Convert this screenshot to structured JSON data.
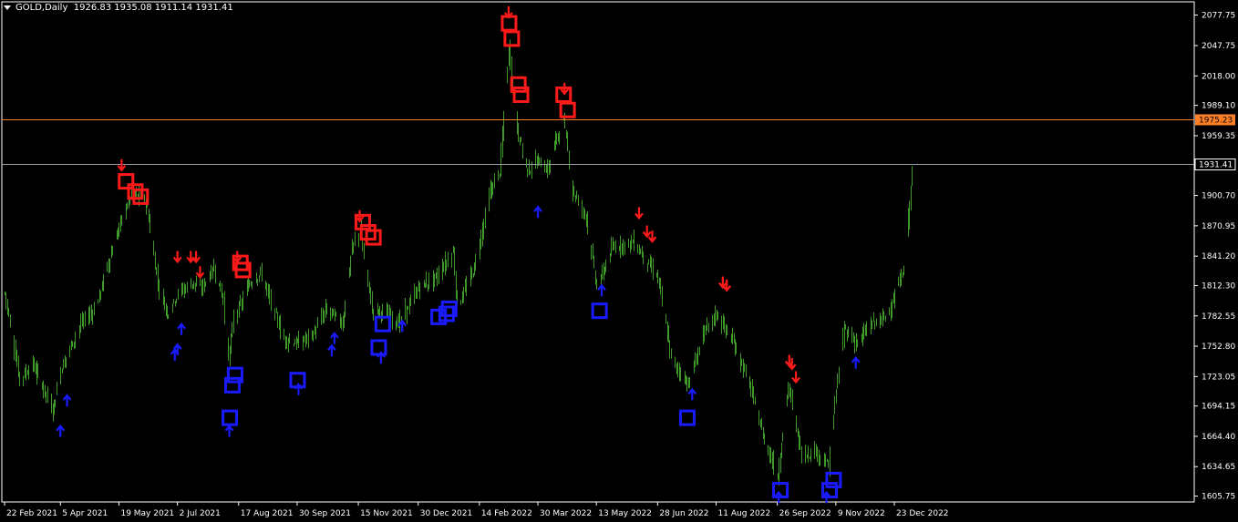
{
  "header": {
    "symbol": "GOLD,Daily",
    "ohlc": "1926.83 1935.08 1911.14 1931.41"
  },
  "colors": {
    "background": "#000000",
    "candle": "#3f9a2a",
    "axis": "#ffffff",
    "sell_signal": "#ff1a1a",
    "buy_signal": "#1a1aff",
    "resistance_line": "#ff7f27",
    "current_line": "#9a9aa8"
  },
  "chart_data": {
    "type": "ohlc-bar",
    "title": "GOLD,Daily",
    "y_ticks": [
      "2077.75",
      "2047.75",
      "2018.00",
      "1989.10",
      "1959.35",
      "1900.70",
      "1870.95",
      "1841.20",
      "1812.30",
      "1782.55",
      "1752.80",
      "1723.05",
      "1694.15",
      "1664.40",
      "1634.65",
      "1605.75"
    ],
    "ylim": [
      1600,
      2088
    ],
    "x_ticks": [
      {
        "label": "22 Feb 2021",
        "date": "2021-02-22"
      },
      {
        "label": "5 Apr 2021",
        "date": "2021-04-05"
      },
      {
        "label": "19 May 2021",
        "date": "2021-05-19"
      },
      {
        "label": "2 Jul 2021",
        "date": "2021-07-02"
      },
      {
        "label": "17 Aug 2021",
        "date": "2021-08-17"
      },
      {
        "label": "30 Sep 2021",
        "date": "2021-09-30"
      },
      {
        "label": "15 Nov 2021",
        "date": "2021-11-15"
      },
      {
        "label": "30 Dec 2021",
        "date": "2021-12-30"
      },
      {
        "label": "14 Feb 2022",
        "date": "2022-02-14"
      },
      {
        "label": "30 Mar 2022",
        "date": "2022-03-30"
      },
      {
        "label": "13 May 2022",
        "date": "2022-05-13"
      },
      {
        "label": "28 Jun 2022",
        "date": "2022-06-28"
      },
      {
        "label": "11 Aug 2022",
        "date": "2022-08-11"
      },
      {
        "label": "26 Sep 2022",
        "date": "2022-09-26"
      },
      {
        "label": "9 Nov 2022",
        "date": "2022-11-09"
      },
      {
        "label": "23 Dec 2022",
        "date": "2022-12-23"
      }
    ],
    "date_range": [
      "2021-02-22",
      "2023-01-05"
    ],
    "series": [
      {
        "points": [
          [
            "2021-02-22",
            1805
          ],
          [
            "2021-03-05",
            1720
          ],
          [
            "2021-03-15",
            1735
          ],
          [
            "2021-03-30",
            1690
          ],
          [
            "2021-04-05",
            1730
          ],
          [
            "2021-04-20",
            1775
          ],
          [
            "2021-05-01",
            1790
          ],
          [
            "2021-05-12",
            1840
          ],
          [
            "2021-05-19",
            1870
          ],
          [
            "2021-05-28",
            1905
          ],
          [
            "2021-06-08",
            1895
          ],
          [
            "2021-06-17",
            1815
          ],
          [
            "2021-06-24",
            1785
          ],
          [
            "2021-07-02",
            1805
          ],
          [
            "2021-07-13",
            1815
          ],
          [
            "2021-07-20",
            1810
          ],
          [
            "2021-07-29",
            1830
          ],
          [
            "2021-08-05",
            1800
          ],
          [
            "2021-08-09",
            1740
          ],
          [
            "2021-08-13",
            1780
          ],
          [
            "2021-08-17",
            1790
          ],
          [
            "2021-08-25",
            1815
          ],
          [
            "2021-09-03",
            1825
          ],
          [
            "2021-09-10",
            1795
          ],
          [
            "2021-09-20",
            1760
          ],
          [
            "2021-09-30",
            1755
          ],
          [
            "2021-10-12",
            1765
          ],
          [
            "2021-10-22",
            1790
          ],
          [
            "2021-11-03",
            1775
          ],
          [
            "2021-11-10",
            1850
          ],
          [
            "2021-11-16",
            1865
          ],
          [
            "2021-11-25",
            1790
          ],
          [
            "2021-12-06",
            1785
          ],
          [
            "2021-12-15",
            1775
          ],
          [
            "2021-12-30",
            1810
          ],
          [
            "2022-01-12",
            1820
          ],
          [
            "2022-01-25",
            1845
          ],
          [
            "2022-01-28",
            1790
          ],
          [
            "2022-02-10",
            1830
          ],
          [
            "2022-02-22",
            1905
          ],
          [
            "2022-03-01",
            1925
          ],
          [
            "2022-03-08",
            2045
          ],
          [
            "2022-03-14",
            1965
          ],
          [
            "2022-03-22",
            1925
          ],
          [
            "2022-03-30",
            1935
          ],
          [
            "2022-04-06",
            1925
          ],
          [
            "2022-04-12",
            1955
          ],
          [
            "2022-04-18",
            1975
          ],
          [
            "2022-04-25",
            1905
          ],
          [
            "2022-05-05",
            1880
          ],
          [
            "2022-05-13",
            1810
          ],
          [
            "2022-05-25",
            1850
          ],
          [
            "2022-06-10",
            1855
          ],
          [
            "2022-06-20",
            1835
          ],
          [
            "2022-06-28",
            1820
          ],
          [
            "2022-07-08",
            1740
          ],
          [
            "2022-07-21",
            1715
          ],
          [
            "2022-08-01",
            1765
          ],
          [
            "2022-08-11",
            1785
          ],
          [
            "2022-08-24",
            1755
          ],
          [
            "2022-09-05",
            1715
          ],
          [
            "2022-09-15",
            1665
          ],
          [
            "2022-09-26",
            1625
          ],
          [
            "2022-10-04",
            1715
          ],
          [
            "2022-10-14",
            1645
          ],
          [
            "2022-10-25",
            1650
          ],
          [
            "2022-11-03",
            1635
          ],
          [
            "2022-11-09",
            1710
          ],
          [
            "2022-11-15",
            1770
          ],
          [
            "2022-11-25",
            1755
          ],
          [
            "2022-12-05",
            1775
          ],
          [
            "2022-12-15",
            1780
          ],
          [
            "2022-12-23",
            1800
          ],
          [
            "2022-12-30",
            1830
          ],
          [
            "2023-01-05",
            1925
          ]
        ]
      }
    ],
    "horizontal_lines": [
      {
        "price": 1975.23,
        "label": "1975.23",
        "color": "#ff7f27",
        "label_style": "filled"
      },
      {
        "price": 1931.41,
        "label": "1931.41",
        "color": "#9a9aa8",
        "label_style": "outline"
      }
    ],
    "signals": {
      "sell_boxes": [
        [
          "2021-05-24",
          1915
        ],
        [
          "2021-05-31",
          1905
        ],
        [
          "2021-06-04",
          1900
        ],
        [
          "2021-11-18",
          1875
        ],
        [
          "2021-11-22",
          1865
        ],
        [
          "2021-11-26",
          1860
        ],
        [
          "2021-08-18",
          1835
        ],
        [
          "2021-08-20",
          1828
        ],
        [
          "2022-03-08",
          2070
        ],
        [
          "2022-03-10",
          2055
        ],
        [
          "2022-03-15",
          2010
        ],
        [
          "2022-03-17",
          2000
        ],
        [
          "2022-04-18",
          2000
        ],
        [
          "2022-04-21",
          1985
        ]
      ],
      "sell_arrows": [
        [
          "2021-05-21",
          1930
        ],
        [
          "2021-07-02",
          1840
        ],
        [
          "2021-07-12",
          1840
        ],
        [
          "2021-07-16",
          1840
        ],
        [
          "2021-07-19",
          1825
        ],
        [
          "2021-08-16",
          1840
        ],
        [
          "2021-11-16",
          1880
        ],
        [
          "2022-03-08",
          2080
        ],
        [
          "2022-04-19",
          2005
        ],
        [
          "2022-06-14",
          1883
        ],
        [
          "2022-06-20",
          1865
        ],
        [
          "2022-06-24",
          1860
        ],
        [
          "2022-08-16",
          1815
        ],
        [
          "2022-08-19",
          1812
        ],
        [
          "2022-10-05",
          1738
        ],
        [
          "2022-10-07",
          1735
        ],
        [
          "2022-10-10",
          1722
        ]
      ],
      "buy_boxes": [
        [
          "2021-08-10",
          1683
        ],
        [
          "2021-08-12",
          1715
        ],
        [
          "2021-08-14",
          1725
        ],
        [
          "2021-09-30",
          1720
        ],
        [
          "2021-11-30",
          1752
        ],
        [
          "2021-12-03",
          1775
        ],
        [
          "2022-01-14",
          1782
        ],
        [
          "2022-01-20",
          1785
        ],
        [
          "2022-01-22",
          1790
        ],
        [
          "2022-05-15",
          1788
        ],
        [
          "2022-07-20",
          1683
        ],
        [
          "2022-09-28",
          1612
        ],
        [
          "2022-11-04",
          1612
        ],
        [
          "2022-11-07",
          1622
        ]
      ],
      "buy_arrows": [
        [
          "2021-04-05",
          1670
        ],
        [
          "2021-04-10",
          1700
        ],
        [
          "2021-06-30",
          1745
        ],
        [
          "2021-07-02",
          1750
        ],
        [
          "2021-07-05",
          1770
        ],
        [
          "2021-08-10",
          1670
        ],
        [
          "2021-10-01",
          1711
        ],
        [
          "2021-10-26",
          1749
        ],
        [
          "2021-10-28",
          1761
        ],
        [
          "2021-12-02",
          1742
        ],
        [
          "2021-12-18",
          1773
        ],
        [
          "2022-03-30",
          1885
        ],
        [
          "2022-05-17",
          1808
        ],
        [
          "2022-07-24",
          1706
        ],
        [
          "2022-09-27",
          1605
        ],
        [
          "2022-11-02",
          1605
        ],
        [
          "2022-11-24",
          1737
        ]
      ]
    }
  }
}
